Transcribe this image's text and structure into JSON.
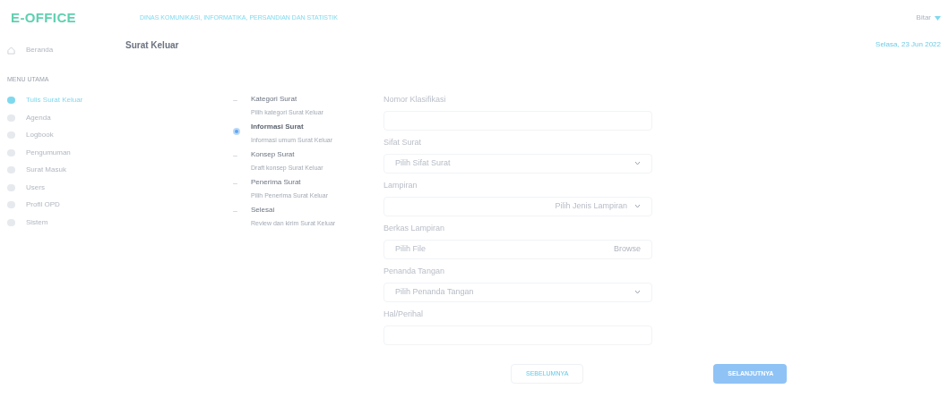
{
  "header": {
    "logo": "E-OFFICE",
    "agency": "DINAS KOMUNIKASI, INFORMATIKA, PERSANDIAN DAN STATISTIK",
    "user": "Bitar"
  },
  "sidebar": {
    "home": "Beranda",
    "section": "MENU UTAMA",
    "items": [
      {
        "label": "Tulis Surat Keluar",
        "selected": true
      },
      {
        "label": "Agenda",
        "selected": false
      },
      {
        "label": "Logbook",
        "selected": false
      },
      {
        "label": "Pengumuman",
        "selected": false
      },
      {
        "label": "Surat Masuk",
        "selected": false
      },
      {
        "label": "Users",
        "selected": false
      },
      {
        "label": "Profil OPD",
        "selected": false
      },
      {
        "label": "Sistem",
        "selected": false
      }
    ]
  },
  "page": {
    "title": "Surat Keluar",
    "date": "Selasa, 23 Jun 2022"
  },
  "steps": [
    {
      "title": "Kategori Surat",
      "subtitle": "Pilih kategori Surat Keluar",
      "selected": false
    },
    {
      "title": "Informasi Surat",
      "subtitle": "Informasi umum Surat Keluar",
      "selected": true
    },
    {
      "title": "Konsep Surat",
      "subtitle": "Draft konsep Surat Keluar",
      "selected": false
    },
    {
      "title": "Penerima Surat",
      "subtitle": "Pilih Penerima Surat Keluar",
      "selected": false
    },
    {
      "title": "Selesai",
      "subtitle": "Review dan kirim Surat Keluar",
      "selected": false
    }
  ],
  "form": [
    {
      "kind": "text",
      "label": "Nomor Klasifikasi"
    },
    {
      "kind": "select",
      "label": "Sifat Surat",
      "placeholder": "Pilih Sifat Surat"
    },
    {
      "kind": "select-right",
      "label": "Lampiran",
      "placeholder": "Pilih Jenis Lampiran"
    },
    {
      "kind": "file",
      "label": "Berkas Lampiran",
      "placeholder": "Pilih File",
      "button": "Browse"
    },
    {
      "kind": "select",
      "label": "Penanda Tangan",
      "placeholder": "Pilih Penanda Tangan"
    },
    {
      "kind": "text",
      "label": "Hal/Perihal"
    }
  ],
  "buttons": {
    "prev": "SEBELUMNYA",
    "next": "SELANJUTNYA"
  }
}
